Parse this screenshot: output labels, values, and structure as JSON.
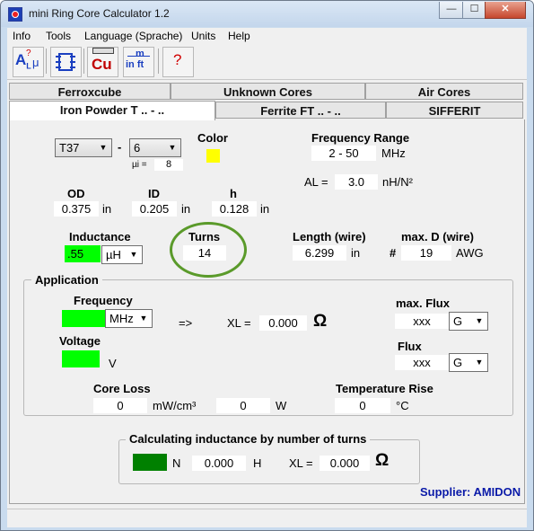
{
  "window": {
    "title": "mini Ring Core Calculator 1.2",
    "minimize": "—",
    "maximize": "☐",
    "close": "✕"
  },
  "menu": [
    "Info",
    "Tools",
    "Language (Sprache)",
    "Units",
    "Help"
  ],
  "toolbar": {
    "al_label": "A",
    "al_sub": "L",
    "mu": "μ",
    "q": "?",
    "cu": "Cu",
    "m_top": "m",
    "m_bottom": "in ft",
    "help": "?"
  },
  "tabs": {
    "row1": [
      "Ferroxcube",
      "Unknown Cores",
      "Air Cores"
    ],
    "row2": [
      "Iron Powder T .. - ..",
      "Ferrite FT .. - ..",
      "SIFFERIT"
    ],
    "active": "Iron Powder T .. - .."
  },
  "core": {
    "size": "T37",
    "dash": "-",
    "material": "6",
    "mu_label": "µi =",
    "mu_value": "8",
    "color_label": "Color",
    "color_value": "#ffff00"
  },
  "frequency_range": {
    "label": "Frequency Range",
    "value": "2 - 50",
    "unit": "MHz"
  },
  "al": {
    "label": "AL =",
    "value": "3.0",
    "unit": "nH/N²"
  },
  "dimensions": {
    "od": {
      "label": "OD",
      "value": "0.375",
      "unit": "in"
    },
    "id": {
      "label": "ID",
      "value": "0.205",
      "unit": "in"
    },
    "h": {
      "label": "h",
      "value": "0.128",
      "unit": "in"
    }
  },
  "inductance": {
    "label": "Inductance",
    "value": ".55",
    "unit": "µH"
  },
  "turns": {
    "label": "Turns",
    "value": "14",
    "highlight_color": "#5a9a2a"
  },
  "wire_length": {
    "label": "Length (wire)",
    "value": "6.299",
    "unit": "in"
  },
  "wire_diameter": {
    "label": "max. D (wire)",
    "prefix": "#",
    "value": "19",
    "unit": "AWG"
  },
  "application": {
    "title": "Application",
    "frequency_label": "Frequency",
    "frequency_unit": "MHz",
    "arrow": "=>",
    "xl_label": "XL =",
    "xl_value": "0.000",
    "ohm": "Ω",
    "voltage_label": "Voltage",
    "voltage_unit": "V",
    "max_flux_label": "max. Flux",
    "max_flux_value": "xxx",
    "max_flux_unit": "G",
    "flux_label": "Flux",
    "flux_value": "xxx",
    "flux_unit": "G",
    "core_loss_label": "Core Loss",
    "core_loss_value": "0",
    "core_loss_unit": "mW/cm³",
    "core_loss_w_value": "0",
    "core_loss_w_unit": "W",
    "temp_rise_label": "Temperature Rise",
    "temp_rise_value": "0",
    "temp_rise_unit": "°C"
  },
  "calc": {
    "title": "Calculating inductance by number of turns",
    "n_label": "N",
    "h_value": "0.000",
    "h_unit": "H",
    "xl_label": "XL =",
    "xl_value": "0.000",
    "ohm": "Ω"
  },
  "supplier": "Supplier: AMIDON"
}
